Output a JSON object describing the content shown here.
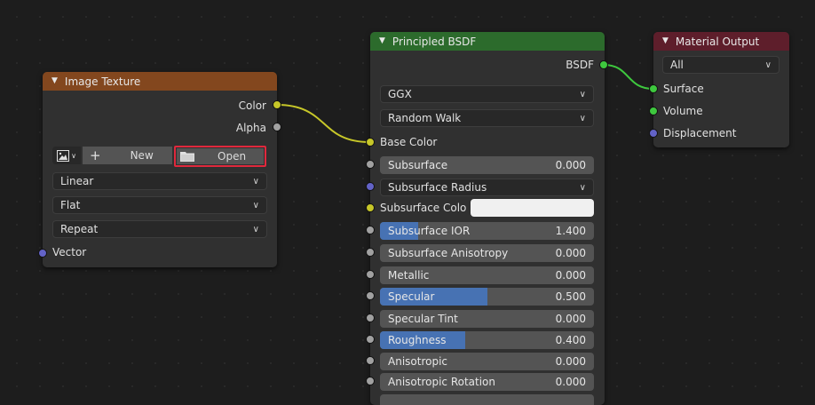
{
  "image_texture": {
    "title": "Image Texture",
    "out_color": "Color",
    "out_alpha": "Alpha",
    "new_label": "New",
    "open_label": "Open",
    "interpolation": "Linear",
    "projection": "Flat",
    "extension": "Repeat",
    "in_vector": "Vector"
  },
  "principled": {
    "title": "Principled BSDF",
    "out_bsdf": "BSDF",
    "distribution": "GGX",
    "subsurface_method": "Random Walk",
    "base_color": "Base Color",
    "subsurface": {
      "label": "Subsurface",
      "value": "0.000"
    },
    "subsurface_radius": "Subsurface Radius",
    "subsurface_color": "Subsurface Colo",
    "subsurface_ior": {
      "label": "Subsurface IOR",
      "value": "1.400",
      "fill": 0.18
    },
    "subsurface_anisotropy": {
      "label": "Subsurface Anisotropy",
      "value": "0.000"
    },
    "metallic": {
      "label": "Metallic",
      "value": "0.000"
    },
    "specular": {
      "label": "Specular",
      "value": "0.500",
      "fill": 0.5
    },
    "specular_tint": {
      "label": "Specular Tint",
      "value": "0.000"
    },
    "roughness": {
      "label": "Roughness",
      "value": "0.400",
      "fill": 0.4
    },
    "anisotropic": {
      "label": "Anisotropic",
      "value": "0.000"
    },
    "anisotropic_rotation": {
      "label": "Anisotropic Rotation",
      "value": "0.000"
    }
  },
  "material_output": {
    "title": "Material Output",
    "target": "All",
    "surface": "Surface",
    "volume": "Volume",
    "displacement": "Displacement"
  },
  "colors": {
    "texture_header": "#83471e",
    "shader_header": "#2c6b2c",
    "output_header": "#5e1e2b",
    "highlight_border": "#e0283c",
    "wire_yellow": "#c7c729",
    "wire_green": "#3ec83e"
  }
}
